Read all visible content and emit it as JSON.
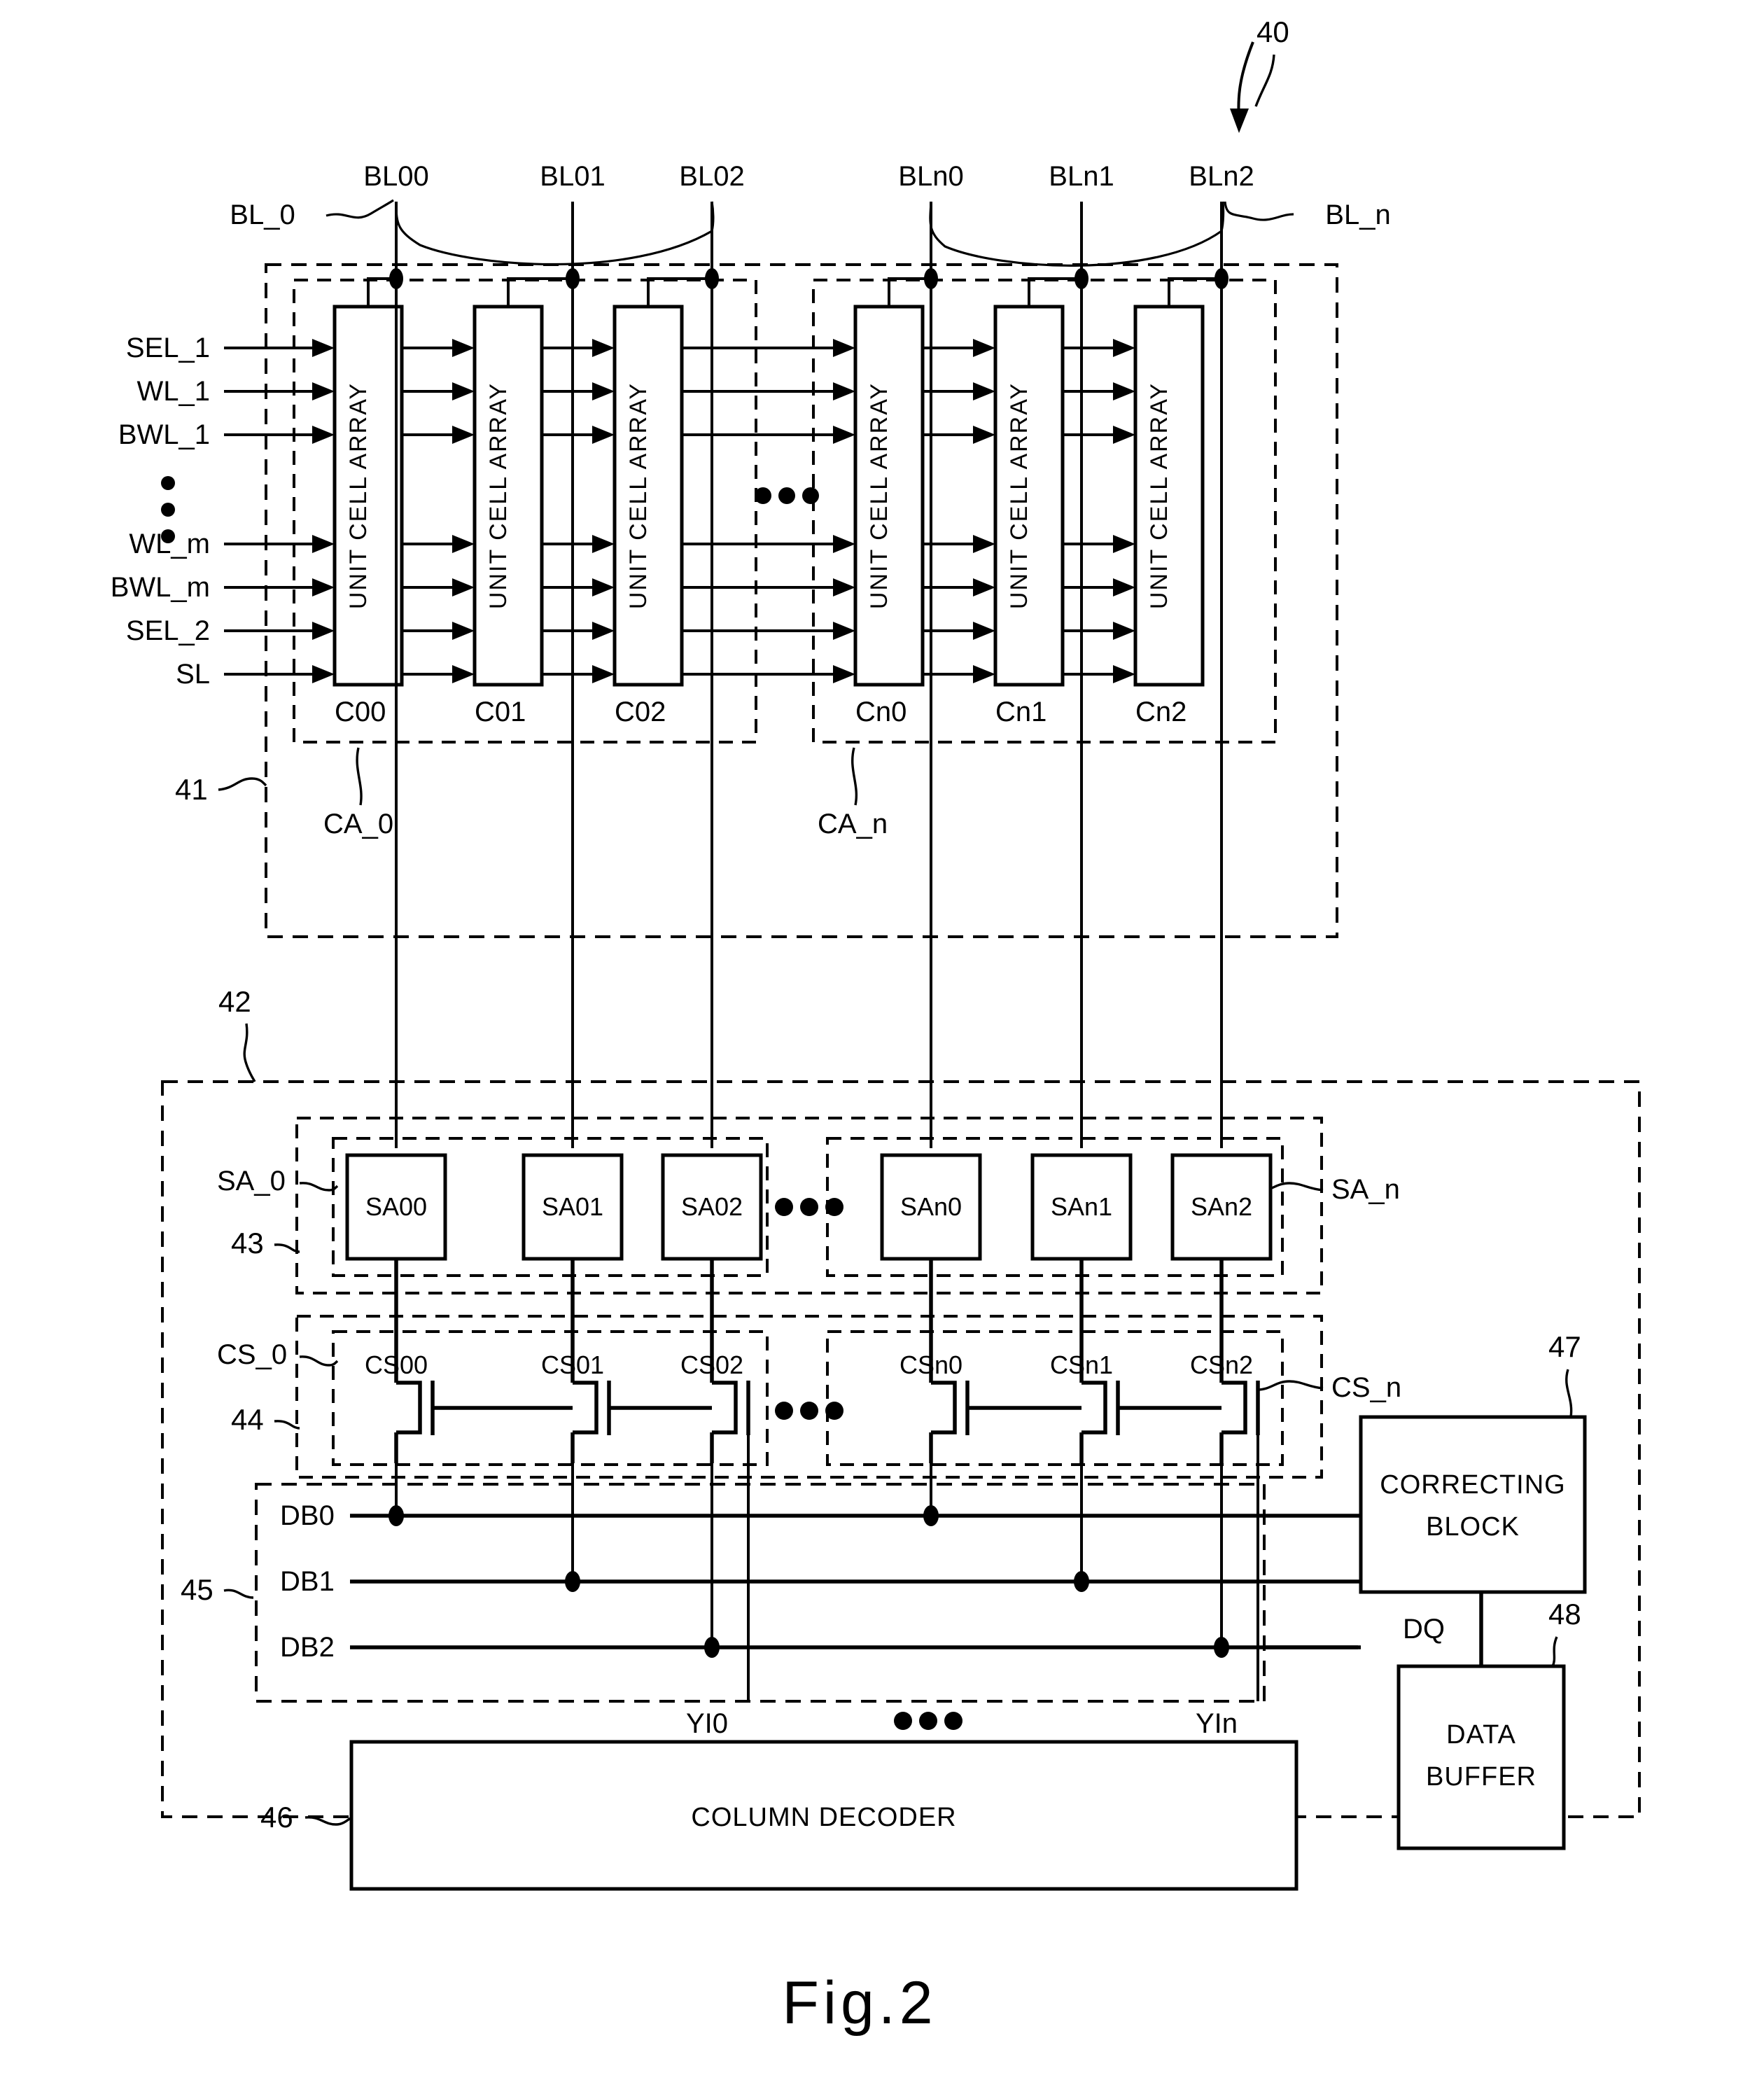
{
  "figure": {
    "caption": "Fig.2",
    "top_ref": "40"
  },
  "bitlines": {
    "group0_label": "BL_0",
    "groupn_label": "BL_n",
    "group0": [
      "BL00",
      "BL01",
      "BL02"
    ],
    "groupn": [
      "BLn0",
      "BLn1",
      "BLn2"
    ]
  },
  "control_lines": [
    "SEL_1",
    "WL_1",
    "BWL_1",
    "WL_m",
    "BWL_m",
    "SEL_2",
    "SL"
  ],
  "cell_array_block": {
    "ref": "41",
    "unit_label": "UNIT CELL ARRAY",
    "group0_label": "CA_0",
    "groupn_label": "CA_n",
    "group0_cells": [
      "C00",
      "C01",
      "C02"
    ],
    "groupn_cells": [
      "Cn0",
      "Cn1",
      "Cn2"
    ],
    "ellipsis": "•••"
  },
  "peripheral_block": {
    "ref": "42"
  },
  "sense_amps": {
    "ref": "43",
    "group0_label": "SA_0",
    "groupn_label": "SA_n",
    "group0": [
      "SA00",
      "SA01",
      "SA02"
    ],
    "groupn": [
      "SAn0",
      "SAn1",
      "SAn2"
    ],
    "ellipsis": "•••"
  },
  "column_selects": {
    "ref": "44",
    "group0_label": "CS_0",
    "groupn_label": "CS_n",
    "group0": [
      "CS00",
      "CS01",
      "CS02"
    ],
    "groupn": [
      "CSn0",
      "CSn1",
      "CSn2"
    ],
    "ellipsis": "•••"
  },
  "data_bus": {
    "ref": "45",
    "lines": [
      "DB0",
      "DB1",
      "DB2"
    ]
  },
  "column_decoder": {
    "ref": "46",
    "label": "COLUMN DECODER",
    "yi_first": "YI0",
    "yi_last": "YIn",
    "ellipsis": "•••"
  },
  "correcting_block": {
    "ref": "47",
    "line1": "CORRECTING",
    "line2": "BLOCK"
  },
  "data_buffer": {
    "ref": "48",
    "line1": "DATA",
    "line2": "BUFFER",
    "dq_label": "DQ"
  },
  "colors": {
    "ink": "#000000",
    "paper": "#ffffff"
  }
}
